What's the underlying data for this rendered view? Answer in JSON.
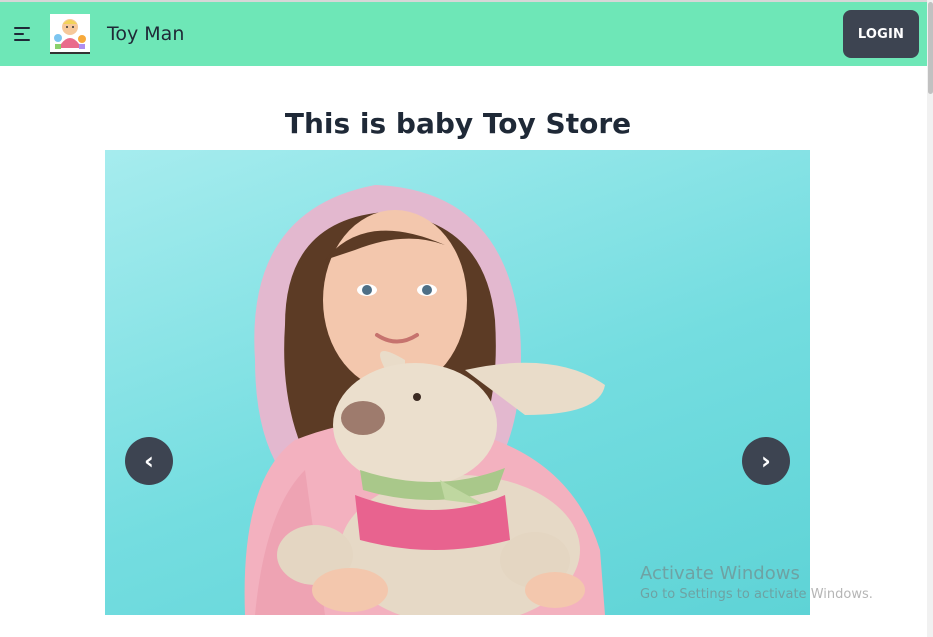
{
  "navbar": {
    "brand": "Toy Man",
    "login_label": "LOGIN",
    "menu_icon": "hamburger-menu-icon",
    "background": "#6ee7b7"
  },
  "main": {
    "heading": "This is baby Toy Store"
  },
  "carousel": {
    "prev_label": "‹",
    "next_label": "›",
    "button_color": "#3d4451"
  },
  "watermark": {
    "title": "Activate Windows",
    "subtitle": "Go to Settings to activate Windows."
  }
}
